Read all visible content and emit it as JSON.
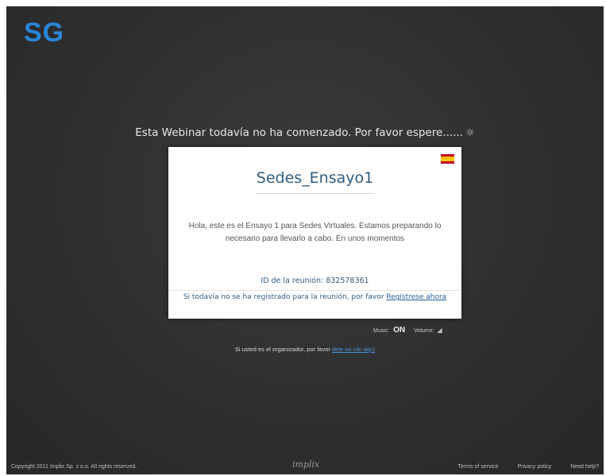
{
  "brand": {
    "logo_text": "SG",
    "accent_color": "#2a86d8"
  },
  "status": {
    "message": "Esta Webinar todavía no ha comenzado.  Por favor espere......",
    "spinner_icon": "loading-sun-icon",
    "spinner_glyph": "☼"
  },
  "card": {
    "language_flag": "spain-flag-icon",
    "title": "Sedes_Ensayo1",
    "description": "Hola, este es el Ensayo 1 para Sedes Virtuales. Estamos preparando lo necesario para llevarlo a cabo. En unos momentos",
    "meeting_id_label": "ID de la reunión:",
    "meeting_id": "832578361",
    "register_text": "Si todavía no se ha registrado para la reunión, por favor",
    "register_link": "Regístrese ahora"
  },
  "controls": {
    "music_label": "Music:",
    "music_value": "ON",
    "volume_label": "Volume:",
    "volume_icon": "volume-icon",
    "volume_glyph": "◢"
  },
  "organizer": {
    "text": "Si usted es el organizador, por favor",
    "link": "dele un clic aquí"
  },
  "footer": {
    "copyright": "Copyright  2011 Implix Sp. z o.o. All rights reserved.",
    "logo": "implix",
    "terms": "Terms of service",
    "privacy": "Privacy policy",
    "help": "Need help?"
  }
}
